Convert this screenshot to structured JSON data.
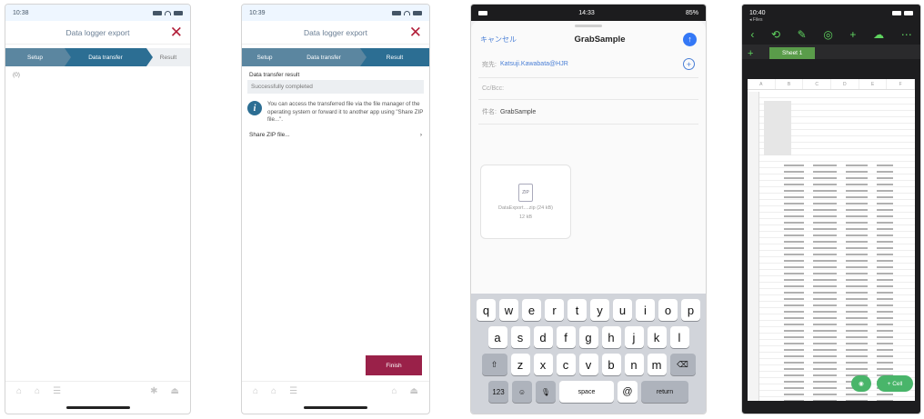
{
  "phone1": {
    "time": "10:38",
    "title": "Data logger export",
    "steps": [
      "Setup",
      "Data transfer",
      "Result"
    ],
    "body_text": "(0)"
  },
  "phone2": {
    "time": "10:39",
    "title": "Data logger export",
    "steps": [
      "Setup",
      "Data transfer",
      "Result"
    ],
    "result_label": "Data transfer result",
    "result_value": "Successfully completed",
    "info_text": "You can access the transferred file via the file manager of the operating system or forward it to another app using \"Share ZIP file...\".",
    "share_label": "Share ZIP file...",
    "share_arrow": "›",
    "finish_label": "Finish"
  },
  "phone3": {
    "time": "14:33",
    "battery": "85%",
    "cancel_label": "キャンセル",
    "title": "GrabSample",
    "to_label": "宛先:",
    "to_value": "Katsuji.Kawabata@HJR",
    "cc_label": "Cc/Bcc:",
    "subject_label": "件名:",
    "subject_value": "GrabSample",
    "file_icon_text": "ZIP",
    "file_name": "DataExport....zip (24 kB)",
    "file_size": "12 kB",
    "keyboard": {
      "row1": [
        "q",
        "w",
        "e",
        "r",
        "t",
        "y",
        "u",
        "i",
        "o",
        "p"
      ],
      "row2": [
        "a",
        "s",
        "d",
        "f",
        "g",
        "h",
        "j",
        "k",
        "l"
      ],
      "row3": [
        "z",
        "x",
        "c",
        "v",
        "b",
        "n",
        "m"
      ],
      "shift": "⇧",
      "delete": "⌫",
      "num": "123",
      "emoji": "☺",
      "mic": "🎙",
      "space": "space",
      "at": "@",
      "return": "return"
    }
  },
  "phone4": {
    "time": "10:40",
    "back_label": "◂ Files",
    "sheet_tab": "Sheet 1",
    "tab_plus": "+",
    "col_headers": [
      "A",
      "B",
      "C",
      "D",
      "E",
      "F"
    ],
    "fab_left": "◉",
    "fab_right": "+ Cell",
    "tool_icons": [
      "‹",
      "⟲",
      "✎",
      "◎",
      "+",
      "☁",
      "⋯"
    ]
  }
}
